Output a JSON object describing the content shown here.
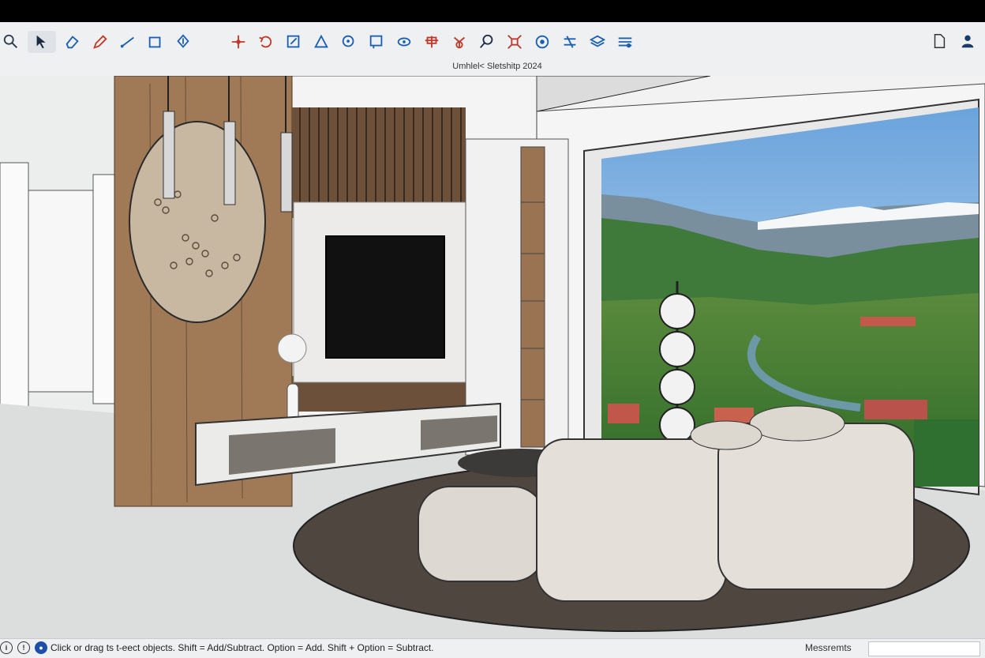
{
  "window": {
    "title": "Umhlel< Sletshitp 2024"
  },
  "toolbar": {
    "tools": [
      {
        "name": "search-icon",
        "color": "#2b3a4a"
      },
      {
        "name": "select-icon",
        "color": "#1a2a40"
      },
      {
        "name": "eraser-icon",
        "color": "#1a5fb4"
      },
      {
        "name": "pencil-icon",
        "color": "#c0392b"
      },
      {
        "name": "line-icon",
        "color": "#1a5fb4"
      },
      {
        "name": "rectangle-icon",
        "color": "#1a5fb4"
      },
      {
        "name": "push-pull-icon",
        "color": "#1a5fb4"
      },
      {
        "name": "offset-icon",
        "color": "#c0392b"
      },
      {
        "name": "move-icon",
        "color": "#c0392b"
      },
      {
        "name": "rotate-icon",
        "color": "#c0392b"
      },
      {
        "name": "scale-icon",
        "color": "#1a5fb4"
      },
      {
        "name": "tape-measure-icon",
        "color": "#1a5fb4"
      },
      {
        "name": "paint-bucket-icon",
        "color": "#1a5fb4"
      },
      {
        "name": "text-icon",
        "color": "#1a5fb4"
      },
      {
        "name": "orbit-icon",
        "color": "#1a5fb4"
      },
      {
        "name": "section-plane-icon",
        "color": "#c0392b"
      },
      {
        "name": "follow-me-icon",
        "color": "#c0392b"
      },
      {
        "name": "zoom-icon",
        "color": "#1a2a40"
      },
      {
        "name": "zoom-extents-icon",
        "color": "#c0392b"
      },
      {
        "name": "position-camera-icon",
        "color": "#1a5fb4"
      },
      {
        "name": "walk-icon",
        "color": "#1a5fb4"
      },
      {
        "name": "layers-icon",
        "color": "#1a5fb4"
      },
      {
        "name": "styles-icon",
        "color": "#1a5fb4"
      }
    ],
    "right_tools": [
      {
        "name": "document-icon"
      },
      {
        "name": "user-icon"
      }
    ]
  },
  "statusbar": {
    "hint": "Click or drag ts t-eect objects. Shift = Add/Subtract. Option = Add. Shift + Option = Subtract.",
    "measurements_label": "Messremts",
    "measurements_value": ""
  }
}
